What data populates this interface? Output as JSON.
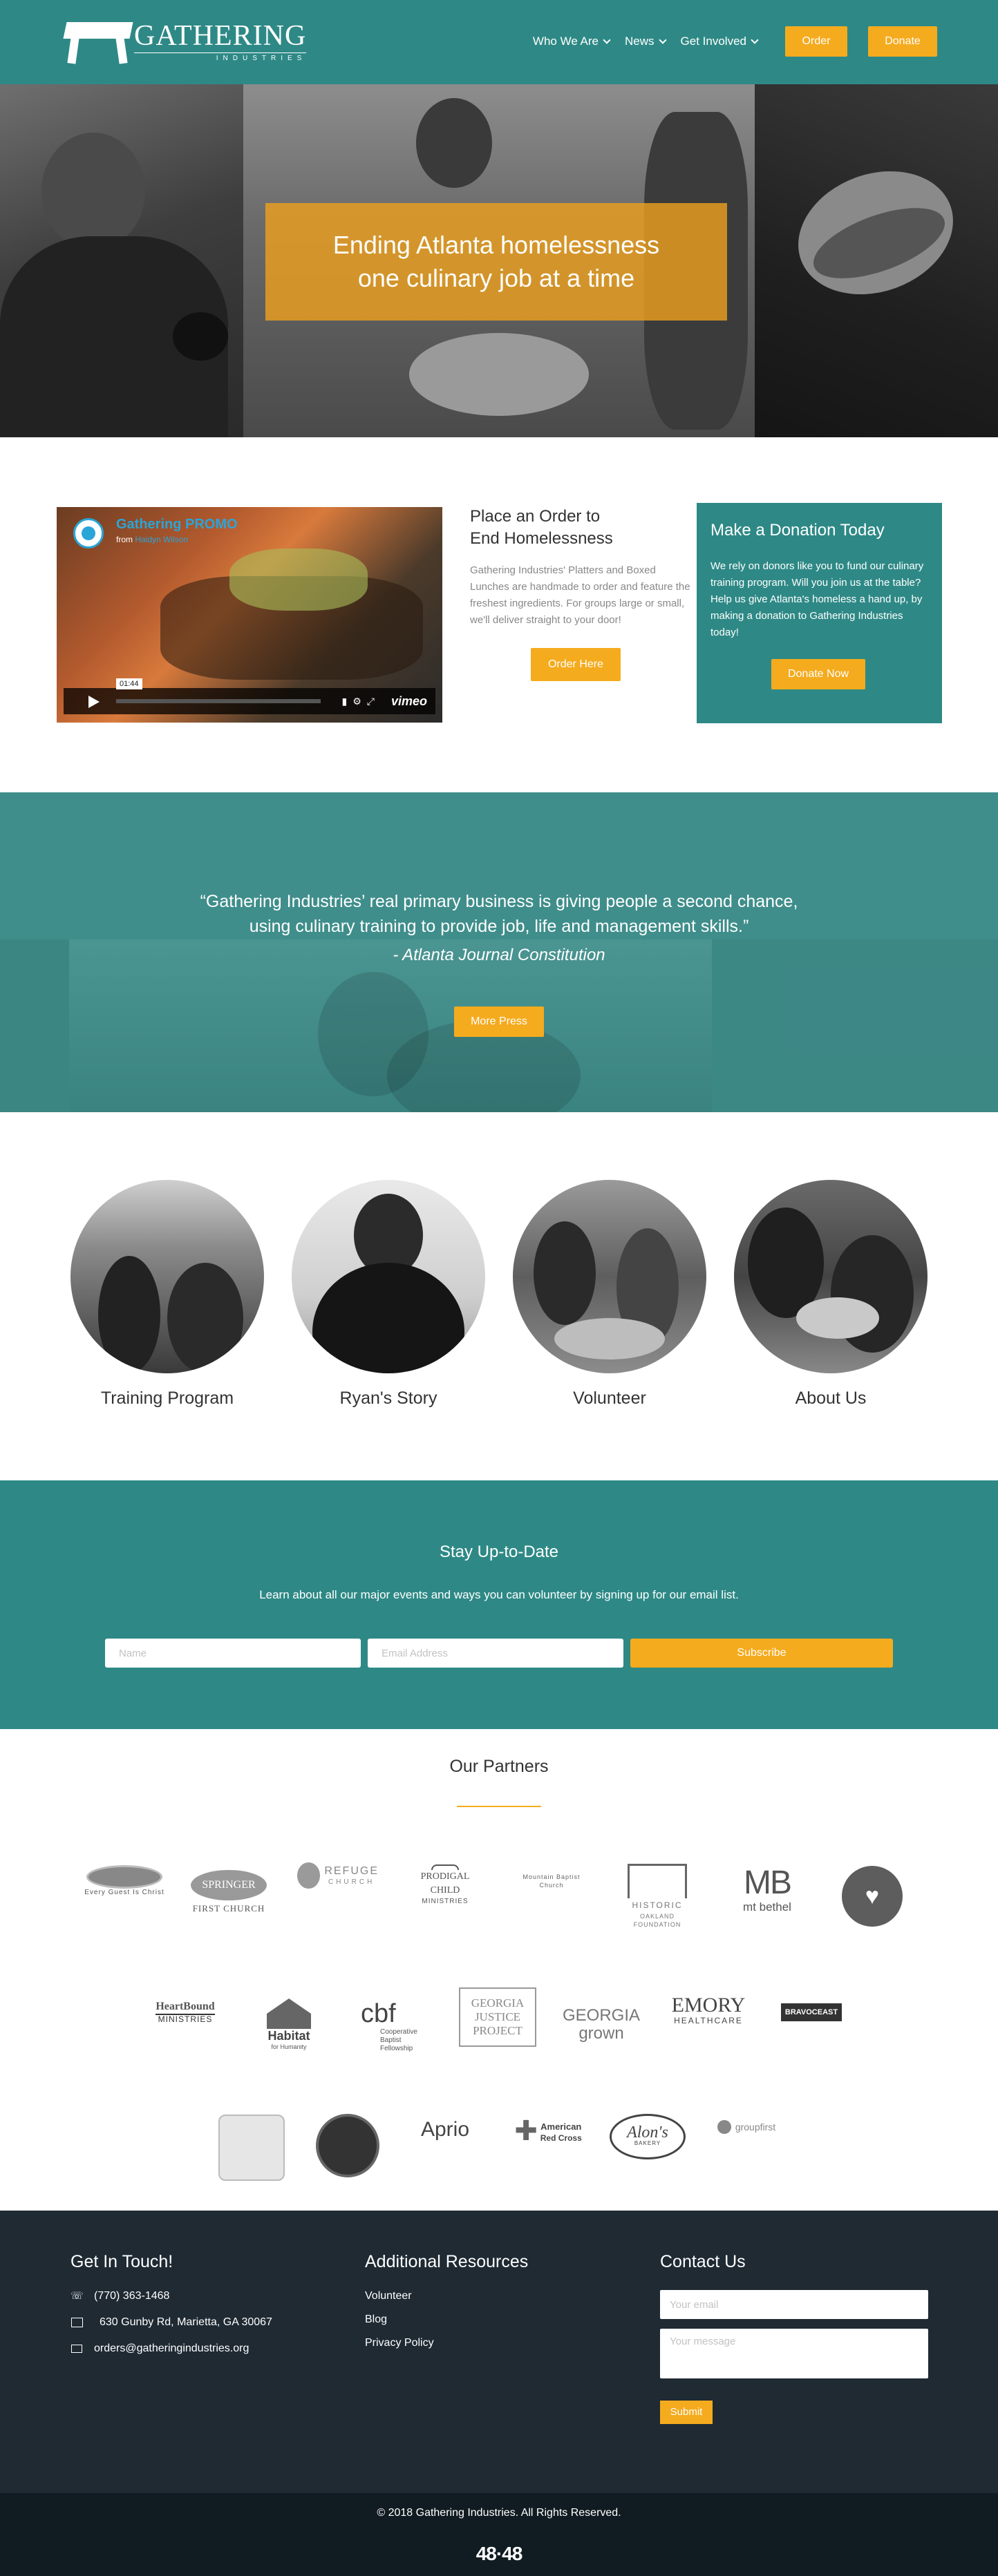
{
  "header": {
    "logo_name": "GATHERING",
    "logo_sub": "INDUSTRIES",
    "nav": [
      {
        "label": "Who We Are"
      },
      {
        "label": "News"
      },
      {
        "label": "Get Involved"
      }
    ],
    "order_label": "Order",
    "donate_label": "Donate"
  },
  "hero": {
    "line1": "Ending Atlanta homelessness",
    "line2": "one culinary job at a time"
  },
  "video": {
    "title": "Gathering PROMO",
    "from_prefix": "from",
    "from_author": "Haidyn Wilson",
    "time": "01:44",
    "brand": "vimeo"
  },
  "order": {
    "title_line1": "Place an Order to",
    "title_line2": "End Homelessness",
    "body": "Gathering Industries' Platters and Boxed Lunches are handmade to order and feature the freshest ingredients. For groups large or small, we'll deliver straight to your door!",
    "button": "Order Here"
  },
  "donation": {
    "title": "Make a Donation Today",
    "body": "We rely on donors like you to fund our culinary training program. Will you join us at the table?  Help us give Atlanta's homeless a hand up, by making a donation to Gathering Industries today!",
    "button": "Donate Now"
  },
  "quote": {
    "line1": "“Gathering Industries’ real primary business is giving people a second chance,",
    "line2": "using culinary training to provide job, life and management skills.”",
    "source": "- Atlanta Journal Constitution",
    "button": "More Press"
  },
  "features": [
    {
      "label": "Training Program"
    },
    {
      "label": "Ryan's Story"
    },
    {
      "label": "Volunteer"
    },
    {
      "label": "About Us"
    }
  ],
  "signup": {
    "title": "Stay Up-to-Date",
    "body": "Learn about all our major events and ways you can volunteer by signing up for our email list.",
    "name_placeholder": "Name",
    "email_placeholder": "Email Address",
    "button": "Subscribe"
  },
  "partners": {
    "title": "Our Partners",
    "row1": [
      {
        "t1": "",
        "t2": "Every Guest Is Christ"
      },
      {
        "t1": "SPRINGER",
        "t2": "FIRST CHURCH"
      },
      {
        "t1": "REFUGE",
        "t2": "CHURCH"
      },
      {
        "t1": "PRODIGAL CHILD",
        "t2": "MINISTRIES"
      },
      {
        "t1": "",
        "t2": "Mountain Baptist Church"
      },
      {
        "t1": "HISTORIC",
        "t2": "OAKLAND FOUNDATION"
      },
      {
        "t1": "MB",
        "t2": "mt bethel"
      },
      {
        "t1": "",
        "t2": ""
      }
    ],
    "row2": [
      {
        "t1": "HeartBound",
        "t2": "MINISTRIES"
      },
      {
        "t1": "Habitat",
        "t2": "for Humanity"
      },
      {
        "t1": "cbf",
        "t2": "Cooperative Baptist Fellowship"
      },
      {
        "t1": "GEORGIA JUSTICE PROJECT",
        "t2": ""
      },
      {
        "t1": "GEORGIA",
        "t2": "grown"
      },
      {
        "t1": "EMORY",
        "t2": "HEALTHCARE"
      },
      {
        "t1": "BRAVOCEAST",
        "t2": ""
      }
    ],
    "row3": [
      {
        "t1": "",
        "t2": ""
      },
      {
        "t1": "",
        "t2": ""
      },
      {
        "t1": "Aprio",
        "t2": ""
      },
      {
        "t1": "American",
        "t2": "Red Cross"
      },
      {
        "t1": "Alon's",
        "t2": "BAKERY"
      },
      {
        "t1": "groupfirst",
        "t2": ""
      }
    ]
  },
  "footer": {
    "touch_title": "Get In Touch!",
    "phone": "(770) 363-1468",
    "address": "630 Gunby Rd, Marietta, GA 30067",
    "email": "orders@gatheringindustries.org",
    "resources_title": "Additional Resources",
    "links": [
      "Volunteer",
      "Blog",
      "Privacy Policy"
    ],
    "contact_title": "Contact Us",
    "email_placeholder": "Your email",
    "message_placeholder": "Your message",
    "submit": "Submit",
    "copyright": "© 2018 Gathering Industries. All Rights Reserved.",
    "brand": "48·48"
  },
  "colors": {
    "teal": "#2e8986",
    "yellow": "#f5ab1e",
    "footer": "#1f2a33"
  }
}
